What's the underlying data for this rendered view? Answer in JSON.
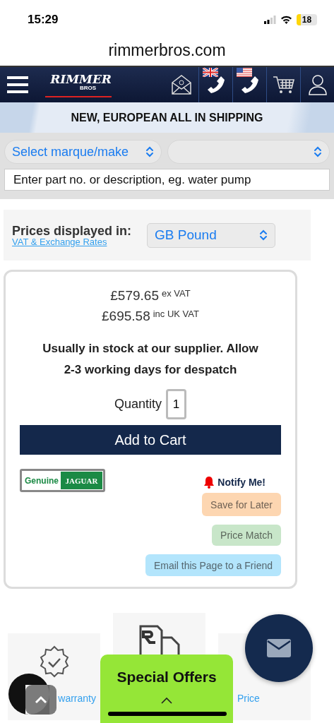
{
  "status_bar": {
    "time": "15:29",
    "battery": "18"
  },
  "url": "rimmerbros.com",
  "header": {
    "logo": "RIMMER",
    "logo_sub": "BROS"
  },
  "banner": "NEW, EUROPEAN ALL IN SHIPPING",
  "search": {
    "make_select": "Select marque/make",
    "placeholder": "Enter part no. or description, eg. water pump"
  },
  "currency": {
    "label": "Prices displayed in:",
    "link": "VAT & Exchange Rates",
    "value": "GB Pound"
  },
  "product": {
    "prices": [
      {
        "amount": "£579.65",
        "note": "ex VAT"
      },
      {
        "amount": "£695.58",
        "note": "inc UK VAT"
      }
    ],
    "stock": "Usually in stock at our supplier. Allow 2-3 working days for despatch",
    "quantity_label": "Quantity",
    "quantity": "1",
    "add_button": "Add to Cart",
    "badge": {
      "genuine": "Genuine",
      "brand": "JAGUAR"
    },
    "notify": "Notify Me!",
    "actions": [
      {
        "label": "Save for Later",
        "color": "#fdd6b1"
      },
      {
        "label": "Price Match",
        "color": "#c8e6c9"
      },
      {
        "label": "Email this Page to a Friend",
        "color": "#b3e5fc"
      }
    ]
  },
  "features": [
    {
      "kind": "warranty",
      "label": "warranty"
    },
    {
      "kind": "delivery"
    },
    {
      "kind": "price",
      "label": "Price"
    }
  ],
  "special_offers": "Special Offers"
}
